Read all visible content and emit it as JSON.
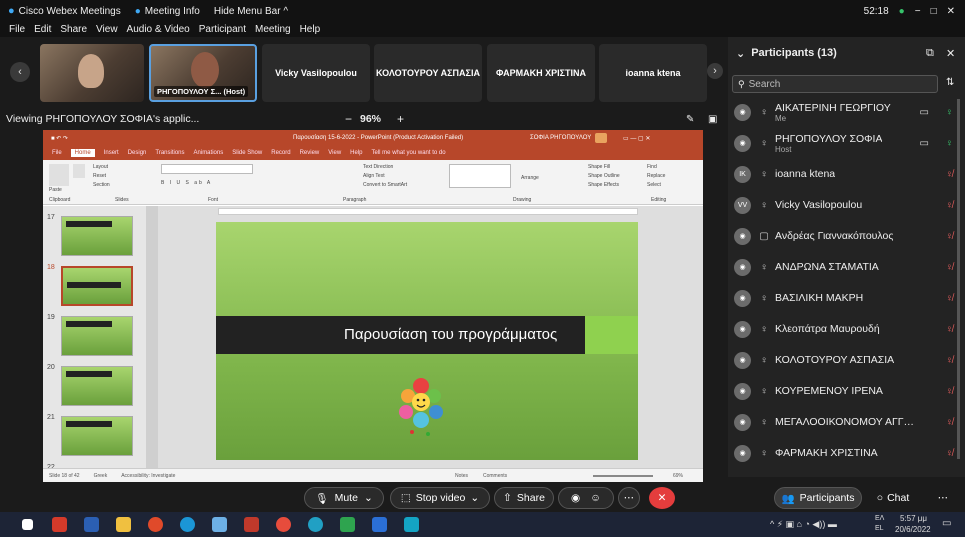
{
  "title_bar": {
    "app": "Cisco Webex Meetings",
    "meeting_info": "Meeting Info",
    "hide_menu": "Hide Menu Bar ^",
    "timer": "52:18"
  },
  "menu": [
    "File",
    "Edit",
    "Share",
    "View",
    "Audio & Video",
    "Participant",
    "Meeting",
    "Help"
  ],
  "strip": {
    "host_tile_label": "ΡΗΓΟΠΟΥΛΟΥ Σ... (Host)",
    "tiles": [
      "Vicky Vasilopoulou",
      "ΚΟΛΟΤΟΥΡΟΥ ΑΣΠΑΣΙΑ",
      "ΦΑΡΜΑΚΗ ΧΡΙΣΤΙΝΑ",
      "ioanna ktena"
    ]
  },
  "viewing": {
    "label": "Viewing ΡΗΓΟΠΟΥΛΟΥ ΣΟΦΙΑ's applic...",
    "zoom": "96%",
    "minus": "−",
    "plus": "+"
  },
  "ppt": {
    "title": "Παρουσίαση 15-6-2022 - PowerPoint (Product Activation Failed)",
    "user": "ΣΟΦΙΑ ΡΗΓΟΠΟΥΛΟΥ",
    "tabs": [
      "File",
      "Home",
      "Insert",
      "Design",
      "Transitions",
      "Animations",
      "Slide Show",
      "Record",
      "Review",
      "View",
      "Help",
      "Tell me what you want to do"
    ],
    "ribbon_groups": [
      "Clipboard",
      "Slides",
      "Font",
      "Paragraph",
      "Drawing",
      "Editing"
    ],
    "ribbon_items": [
      "Paste",
      "New Slide",
      "Layout",
      "Reset",
      "Section",
      "Text Direction",
      "Align Text",
      "Convert to SmartArt",
      "Arrange",
      "Quick Styles",
      "Shape Fill",
      "Shape Outline",
      "Shape Effects",
      "Find",
      "Replace",
      "Select"
    ],
    "slide_numbers": [
      "17",
      "18",
      "19",
      "20",
      "21",
      "22"
    ],
    "slide_title": "Παρουσίαση του προγράμματος",
    "status": {
      "slide": "Slide 18 of 42",
      "lang": "Greek",
      "access": "Accessibility: Investigate",
      "notes": "Notes",
      "comments": "Comments",
      "zoom": "69%"
    }
  },
  "participants": {
    "header": "Participants (13)",
    "search_placeholder": "Search",
    "list": [
      {
        "initials": "",
        "name": "ΑΙΚΑΤΕΡΙΝΗ ΓΕΩΡΓΙΟΥ",
        "sub": "Me",
        "mic": "on",
        "muted": false,
        "video": true
      },
      {
        "initials": "",
        "name": "ΡΗΓΟΠΟΥΛΟΥ ΣΟΦΙΑ",
        "sub": "Host",
        "mic": "on",
        "muted": false,
        "video": true
      },
      {
        "initials": "IK",
        "name": "ioanna ktena",
        "sub": "",
        "mic": "on",
        "muted": true,
        "video": false
      },
      {
        "initials": "VV",
        "name": "Vicky Vasilopoulou",
        "sub": "",
        "mic": "on",
        "muted": true,
        "video": false
      },
      {
        "initials": "",
        "name": "Ανδρέας Γιαννακόπουλος",
        "sub": "",
        "mic": "device",
        "muted": true,
        "video": false
      },
      {
        "initials": "",
        "name": "ΑΝΔΡΩΝΑ ΣΤΑΜΑΤΙΑ",
        "sub": "",
        "mic": "on",
        "muted": true,
        "video": false
      },
      {
        "initials": "",
        "name": "ΒΑΣΙΛΙΚΗ ΜΑΚΡΗ",
        "sub": "",
        "mic": "on",
        "muted": true,
        "video": false
      },
      {
        "initials": "",
        "name": "Κλεοπάτρα Μαυρουδή",
        "sub": "",
        "mic": "on",
        "muted": true,
        "video": false
      },
      {
        "initials": "",
        "name": "ΚΟΛΟΤΟΥΡΟΥ ΑΣΠΑΣΙΑ",
        "sub": "",
        "mic": "on",
        "muted": true,
        "video": false
      },
      {
        "initials": "",
        "name": "ΚΟΥΡΕΜΕΝΟΥ ΙΡΕΝΑ",
        "sub": "",
        "mic": "on",
        "muted": true,
        "video": false
      },
      {
        "initials": "",
        "name": "ΜΕΓΑΛΟΟΙΚΟΝΟΜΟΥ ΑΓΓΕΛ...",
        "sub": "",
        "mic": "on",
        "muted": true,
        "video": false
      },
      {
        "initials": "",
        "name": "ΦΑΡΜΑΚΗ ΧΡΙΣΤΙΝΑ",
        "sub": "",
        "mic": "on",
        "muted": true,
        "video": false
      }
    ]
  },
  "controls": {
    "mute": "Mute",
    "stop_video": "Stop video",
    "share": "Share",
    "participants": "Participants",
    "chat": "Chat"
  },
  "taskbar": {
    "lang": "ΕΛ",
    "lang2": "EL",
    "time": "5:57 μμ",
    "date": "20/6/2022"
  },
  "colors": {
    "accent": "#3c8d3c",
    "ppt": "#b7472a",
    "end": "#e43d3d",
    "mute": "#e25c5c"
  }
}
